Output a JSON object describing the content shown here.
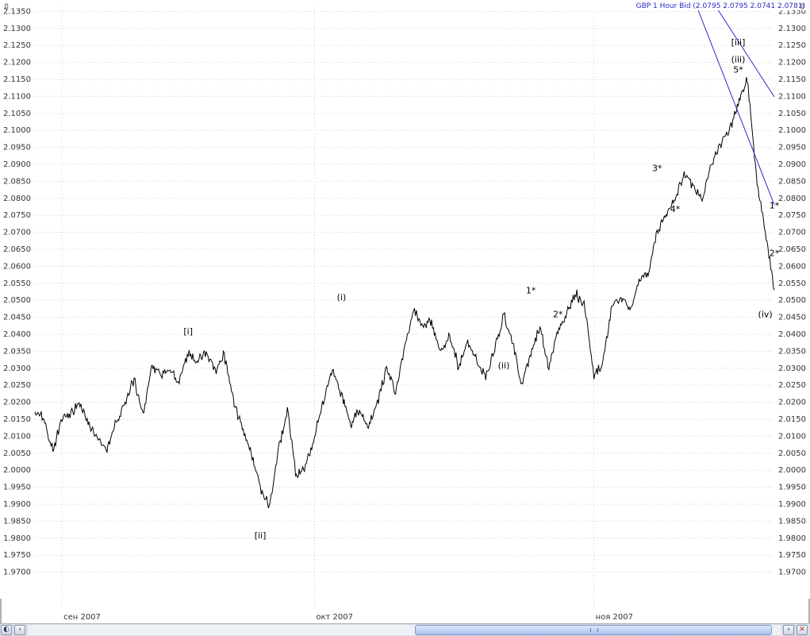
{
  "window": {
    "title": "GBP 1 Hour Bid (2.0795 2.0795 2.0741 2.0781)"
  },
  "colors": {
    "background": "#ffffff",
    "grid": "#cfcfcf",
    "price": "#000000",
    "forecast": "#2a2ac8",
    "tick_text": "#333333"
  },
  "icons": {
    "scale_left": "scale-arrows-icon",
    "scale_right": "scale-arrows-icon"
  },
  "chart_data": {
    "type": "line",
    "title": "GBP 1 Hour Bid (2.0795 2.0795 2.0741 2.0781)",
    "xlabel": "",
    "ylabel": "",
    "ylim": [
      1.965,
      2.1365
    ],
    "grid": true,
    "y_ticks": [
      "1.9700",
      "1.9750",
      "1.9800",
      "1.9850",
      "1.9900",
      "1.9950",
      "2.0000",
      "2.0050",
      "2.0100",
      "2.0150",
      "2.0200",
      "2.0250",
      "2.0300",
      "2.0350",
      "2.0400",
      "2.0450",
      "2.0500",
      "2.0550",
      "2.0600",
      "2.0650",
      "2.0700",
      "2.0750",
      "2.0800",
      "2.0850",
      "2.0900",
      "2.0950",
      "2.1000",
      "2.1050",
      "2.1100",
      "2.1150",
      "2.1200",
      "2.1250",
      "2.1300",
      "2.1350"
    ],
    "x_ticks": [
      {
        "label": "сен 2007",
        "x": "2007-09-03"
      },
      {
        "label": "окт 2007",
        "x": "2007-10-01"
      },
      {
        "label": "ноя 2007",
        "x": "2007-11-01"
      }
    ],
    "xlim": [
      "2007-08-31",
      "2007-11-21"
    ],
    "series": [
      {
        "points": [
          [
            "2007-08-31",
            2.0175
          ],
          [
            "2007-09-01",
            2.015
          ],
          [
            "2007-09-02",
            2.0055
          ],
          [
            "2007-09-03",
            2.015
          ],
          [
            "2007-09-04",
            2.017
          ],
          [
            "2007-09-05",
            2.0195
          ],
          [
            "2007-09-06",
            2.0135
          ],
          [
            "2007-09-08",
            2.006
          ],
          [
            "2007-09-09",
            2.014
          ],
          [
            "2007-09-10",
            2.02
          ],
          [
            "2007-09-11",
            2.027
          ],
          [
            "2007-09-12",
            2.016
          ],
          [
            "2007-09-13",
            2.031
          ],
          [
            "2007-09-14",
            2.028
          ],
          [
            "2007-09-15",
            2.03
          ],
          [
            "2007-09-16",
            2.026
          ],
          [
            "2007-09-17",
            2.034
          ],
          [
            "2007-09-18",
            2.032
          ],
          [
            "2007-09-19",
            2.035
          ],
          [
            "2007-09-20",
            2.029
          ],
          [
            "2007-09-21",
            2.034
          ],
          [
            "2007-09-22",
            2.021
          ],
          [
            "2007-09-23",
            2.012
          ],
          [
            "2007-09-24",
            2.005
          ],
          [
            "2007-09-25",
            1.995
          ],
          [
            "2007-09-26",
            1.989
          ],
          [
            "2007-09-27",
            2.006
          ],
          [
            "2007-09-28",
            2.018
          ],
          [
            "2007-09-29",
            1.998
          ],
          [
            "2007-09-30",
            2.001
          ],
          [
            "2007-10-01",
            2.01
          ],
          [
            "2007-10-02",
            2.02
          ],
          [
            "2007-10-03",
            2.03
          ],
          [
            "2007-10-04",
            2.022
          ],
          [
            "2007-10-05",
            2.013
          ],
          [
            "2007-10-06",
            2.018
          ],
          [
            "2007-10-07",
            2.013
          ],
          [
            "2007-10-08",
            2.02
          ],
          [
            "2007-10-09",
            2.03
          ],
          [
            "2007-10-10",
            2.023
          ],
          [
            "2007-10-11",
            2.036
          ],
          [
            "2007-10-12",
            2.047
          ],
          [
            "2007-10-13",
            2.042
          ],
          [
            "2007-10-14",
            2.044
          ],
          [
            "2007-10-15",
            2.035
          ],
          [
            "2007-10-16",
            2.04
          ],
          [
            "2007-10-17",
            2.03
          ],
          [
            "2007-10-18",
            2.038
          ],
          [
            "2007-10-19",
            2.032
          ],
          [
            "2007-10-20",
            2.027
          ],
          [
            "2007-10-21",
            2.036
          ],
          [
            "2007-10-22",
            2.046
          ],
          [
            "2007-10-23",
            2.037
          ],
          [
            "2007-10-24",
            2.025
          ],
          [
            "2007-10-25",
            2.034
          ],
          [
            "2007-10-26",
            2.042
          ],
          [
            "2007-10-27",
            2.03
          ],
          [
            "2007-10-28",
            2.041
          ],
          [
            "2007-10-29",
            2.046
          ],
          [
            "2007-10-30",
            2.052
          ],
          [
            "2007-10-31",
            2.048
          ],
          [
            "2007-11-01",
            2.027
          ],
          [
            "2007-11-02",
            2.032
          ],
          [
            "2007-11-03",
            2.048
          ],
          [
            "2007-11-04",
            2.051
          ],
          [
            "2007-11-05",
            2.047
          ],
          [
            "2007-11-06",
            2.056
          ],
          [
            "2007-11-07",
            2.058
          ],
          [
            "2007-11-08",
            2.07
          ],
          [
            "2007-11-09",
            2.076
          ],
          [
            "2007-11-10",
            2.08
          ],
          [
            "2007-11-11",
            2.087
          ],
          [
            "2007-11-12",
            2.083
          ],
          [
            "2007-11-13",
            2.08
          ],
          [
            "2007-11-14",
            2.089
          ],
          [
            "2007-11-15",
            2.096
          ],
          [
            "2007-11-16",
            2.1
          ],
          [
            "2007-11-17",
            2.108
          ],
          [
            "2007-11-18",
            2.115
          ],
          [
            "2007-11-19",
            2.087
          ],
          [
            "2007-11-20",
            2.07
          ],
          [
            "2007-11-21",
            2.053
          ]
        ]
      },
      {
        "points": [
          [
            "2007-11-21",
            2.0781
          ],
          [
            "2007-11-22",
            2.138
          ]
        ]
      }
    ],
    "annotations": [
      {
        "text": "[i]",
        "x": "2007-09-17",
        "y": 2.04
      },
      {
        "text": "[ii]",
        "x": "2007-09-25",
        "y": 1.98
      },
      {
        "text": "(i)",
        "x": "2007-10-04",
        "y": 2.05
      },
      {
        "text": "(ii)",
        "x": "2007-10-22",
        "y": 2.03
      },
      {
        "text": "1*",
        "x": "2007-10-25",
        "y": 2.052
      },
      {
        "text": "2*",
        "x": "2007-10-28",
        "y": 2.045
      },
      {
        "text": "3*",
        "x": "2007-11-08",
        "y": 2.088
      },
      {
        "text": "4*",
        "x": "2007-11-10",
        "y": 2.076
      },
      {
        "text": "[iii]",
        "x": "2007-11-17",
        "y": 2.125
      },
      {
        "text": "(iii)",
        "x": "2007-11-17",
        "y": 2.12
      },
      {
        "text": "5*",
        "x": "2007-11-17",
        "y": 2.117
      },
      {
        "text": "1*",
        "x": "2007-11-21",
        "y": 2.077
      },
      {
        "text": "2*",
        "x": "2007-11-21",
        "y": 2.063
      },
      {
        "text": "(iv)",
        "x": "2007-11-20",
        "y": 2.045
      }
    ]
  },
  "scrollbar": {
    "prev_symbol": "‹",
    "next_symbol": "›"
  }
}
